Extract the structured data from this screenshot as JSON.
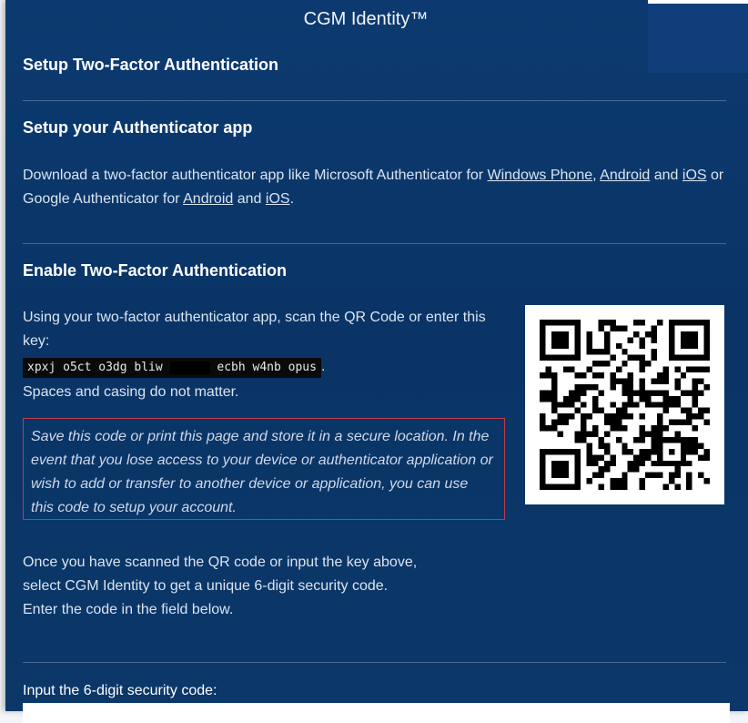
{
  "header": {
    "title": "CGM Identity™"
  },
  "page": {
    "heading": "Setup Two-Factor Authentication"
  },
  "step1": {
    "heading": "Setup your Authenticator app",
    "text_1": "Download a two-factor authenticator app like Microsoft Authenticator for",
    "link_windows_phone": "Windows Phone",
    "sep_comma": ",",
    "link_android_1": "Android",
    "text_2": "and",
    "link_ios_1": "iOS",
    "text_3": "or Google Authenticator for",
    "link_android_2": "Android",
    "text_4": "and",
    "link_ios_2": "iOS",
    "text_5": "."
  },
  "step2": {
    "heading": "Enable Two-Factor Authentication",
    "instruction": "Using your two-factor authenticator app, scan the QR Code or enter this key:",
    "key_part1": "xpxj o5ct o3dg bliw",
    "key_part2": "ecbh w4nb opus",
    "key_period": ".",
    "note": "Spaces and casing do not matter.",
    "warning": "Save this code or print this page and store it in a secure location. In the event that you lose access to your device or authenticator application or wish to add or transfer to another device or application, you can use this code to setup your account."
  },
  "step3": {
    "line1": "Once you have scanned the QR code or input the key above,",
    "line2": "select CGM Identity to get a unique 6-digit security code.",
    "line3": "Enter the code in the field below."
  },
  "code_input": {
    "label": "Input the 6-digit security code:",
    "value": ""
  }
}
